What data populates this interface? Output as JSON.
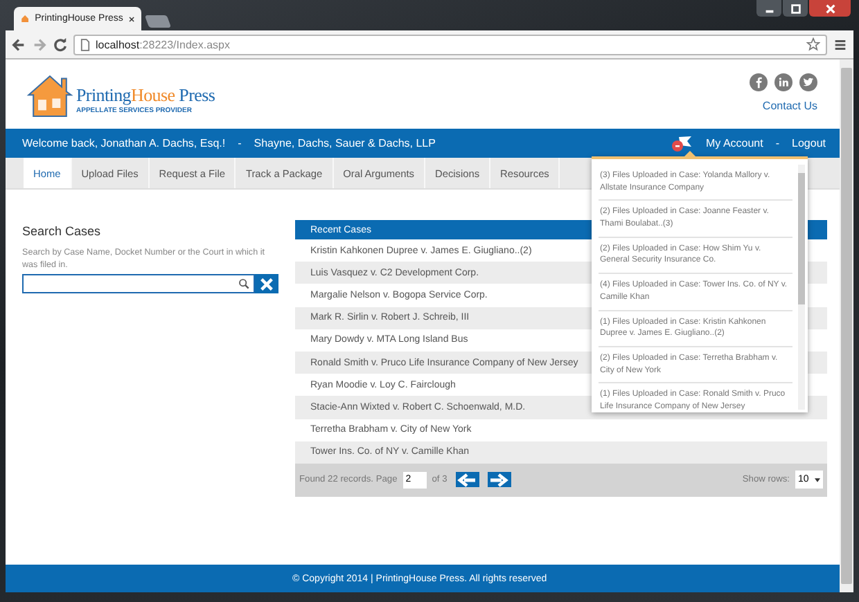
{
  "browser": {
    "tab_title": "PrintingHouse Press",
    "url_host": "localhost",
    "url_rest": ":28223/Index.aspx"
  },
  "header": {
    "brand_first": "Printing",
    "brand_accent": "House",
    "brand_last": " Press",
    "tagline": "APPELLATE SERVICES PROVIDER",
    "contact": "Contact Us"
  },
  "user_bar": {
    "welcome": "Welcome back, Jonathan A. Dachs, Esq.!",
    "separator": "-",
    "firm": "Shayne, Dachs, Sauer & Dachs, LLP",
    "account": "My Account",
    "separator_2": "-",
    "logout": "Logout"
  },
  "tabs": [
    {
      "label": "Home",
      "selected": true
    },
    {
      "label": "Upload Files",
      "selected": false
    },
    {
      "label": "Request a File",
      "selected": false
    },
    {
      "label": "Track a Package",
      "selected": false
    },
    {
      "label": "Oral Arguments",
      "selected": false
    },
    {
      "label": "Decisions",
      "selected": false
    },
    {
      "label": "Resources",
      "selected": false
    }
  ],
  "search": {
    "title": "Search Cases",
    "hint": "Search by Case Name, Docket Number or the Court in which it was filed in."
  },
  "recent_cases": {
    "title": "Recent Cases",
    "rows": [
      "Kristin Kahkonen Dupree v. James E. Giugliano..(2)",
      "Luis Vasquez v. C2 Development Corp.",
      "Margalie Nelson v. Bogopa Service Corp.",
      "Mark R. Sirlin v. Robert J. Schreib, III",
      "Mary Dowdy v. MTA Long Island Bus",
      "Ronald Smith v. Pruco Life Insurance Company of New Jersey",
      "Ryan Moodie v. Loy C. Fairclough",
      "Stacie-Ann Wixted v. Robert C. Schoenwald, M.D.",
      "Terretha Brabham v. City of New York",
      "Tower Ins. Co. of NY v. Camille Khan"
    ],
    "pager": {
      "found": "Found 22 records. Page",
      "page": "2",
      "of": "of 3",
      "show_rows": "Show rows:",
      "rows_value": "10"
    }
  },
  "notifications": [
    "(3) Files Uploaded in Case: Yolanda Mallory v. Allstate Insurance Company",
    "(2) Files Uploaded in Case: Joanne Feaster v. Thami Boulabat..(3)",
    "(2) Files Uploaded in Case: How Shim Yu v. General Security Insurance Co.",
    "(4) Files Uploaded in Case: Tower Ins. Co. of NY v. Camille Khan",
    "(1) Files Uploaded in Case: Kristin Kahkonen Dupree v. James E. Giugliano..(2)",
    "(2) Files Uploaded in Case: Terretha Brabham v. City of New York",
    "(1) Files Uploaded in Case: Ronald Smith v. Pruco Life Insurance Company of New Jersey"
  ],
  "footer": "© Copyright 2014 | PrintingHouse Press. All rights reserved"
}
